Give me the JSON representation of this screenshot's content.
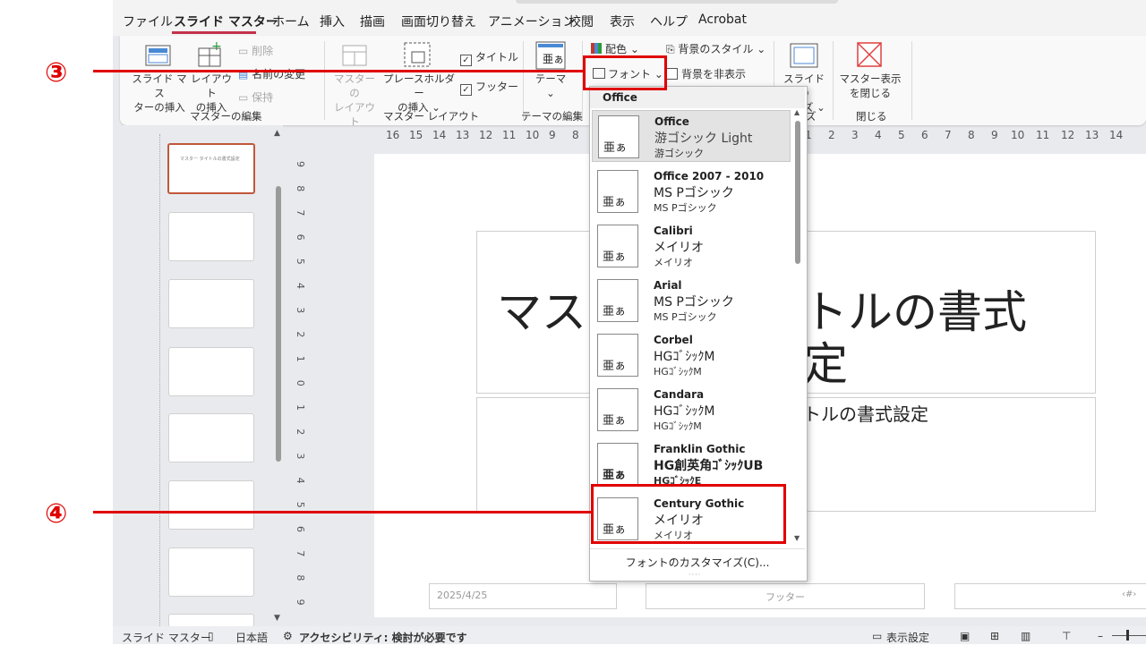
{
  "menubar": {
    "tabs": [
      "ファイル",
      "スライド マスター",
      "ホーム",
      "挿入",
      "描画",
      "画面切り替え",
      "アニメーション",
      "校閲",
      "表示",
      "ヘルプ",
      "Acrobat"
    ]
  },
  "ribbon": {
    "master_edit": {
      "insert_master": "スライド マス\nターの挿入",
      "insert_layout": "レイアウト\nの挿入",
      "delete": "削除",
      "rename": "名前の変更",
      "preserve": "保持",
      "group_label": "マスターの編集"
    },
    "master_layout": {
      "master_layout_btn": "マスターの\nレイアウト",
      "insert_placeholder": "プレースホルダー\nの挿入 ⌄",
      "title_check": "タイトル",
      "footer_check": "フッター",
      "group_label": "マスター レイアウト"
    },
    "theme_edit": {
      "theme": "テーマ\n⌄",
      "group_label": "テーマの編集"
    },
    "background": {
      "colors": "配色 ⌄",
      "fonts": "フォント ⌄",
      "bg_style": "背景のスタイル ⌄",
      "hide_bg": "背景を非表示"
    },
    "size": {
      "slide_size": "スライドの\nサイズ ⌄",
      "group_label": "ズ"
    },
    "close": {
      "close_master": "マスター表示\nを閉じる",
      "group_label": "閉じる"
    }
  },
  "fonts_dropdown": {
    "header": "Office",
    "items": [
      {
        "name": "Office",
        "heading": "游ゴシック Light",
        "body": "游ゴシック",
        "sample": "亜ぁ"
      },
      {
        "name": "Office 2007 - 2010",
        "heading": "MS Pゴシック",
        "body": "MS Pゴシック",
        "sample": "亜ぁ"
      },
      {
        "name": "Calibri",
        "heading": "メイリオ",
        "body": "メイリオ",
        "sample": "亜ぁ"
      },
      {
        "name": "Arial",
        "heading": "MS Pゴシック",
        "body": "MS Pゴシック",
        "sample": "亜ぁ"
      },
      {
        "name": "Corbel",
        "heading": "HGｺﾞｼｯｸM",
        "body": "HGｺﾞｼｯｸM",
        "sample": "亜ぁ"
      },
      {
        "name": "Candara",
        "heading": "HGｺﾞｼｯｸM",
        "body": "HGｺﾞｼｯｸM",
        "sample": "亜ぁ"
      },
      {
        "name": "Franklin Gothic",
        "heading": "HG創英角ｺﾞｼｯｸUB",
        "body": "HGｺﾞｼｯｸE",
        "sample": "亜ぁ"
      },
      {
        "name": "Century Gothic",
        "heading": "メイリオ",
        "body": "メイリオ",
        "sample": "亜ぁ"
      }
    ],
    "customize": "フォントのカスタマイズ(C)..."
  },
  "ruler_h": [
    "16",
    "15",
    "14",
    "13",
    "12",
    "11",
    "10",
    "9",
    "8",
    "1",
    "2",
    "3",
    "4",
    "5",
    "6",
    "7",
    "8",
    "9",
    "10",
    "11",
    "12",
    "13",
    "14"
  ],
  "ruler_v": [
    "9",
    "8",
    "7",
    "6",
    "5",
    "4",
    "3",
    "2",
    "1",
    "0",
    "1",
    "2",
    "3",
    "4",
    "5",
    "6",
    "7",
    "8",
    "9"
  ],
  "slide": {
    "title_left": "マス",
    "title_right": "トルの書式",
    "title_line2": "定",
    "subtitle": "トルの書式設定",
    "date": "2025/4/25",
    "footer": "フッター",
    "page": "‹#›"
  },
  "thumb_title": "マスター タイトルの書式設定",
  "status": {
    "view": "スライド マスター",
    "language": "日本語",
    "accessibility": "アクセシビリティ: 検討が必要です",
    "display_settings": "表示設定"
  },
  "annotations": {
    "marker3": "③",
    "marker4": "④"
  },
  "colors": {
    "accent_red": "#e00000",
    "tab_underline": "#c4314b",
    "selected_thumb": "#c0573a"
  }
}
